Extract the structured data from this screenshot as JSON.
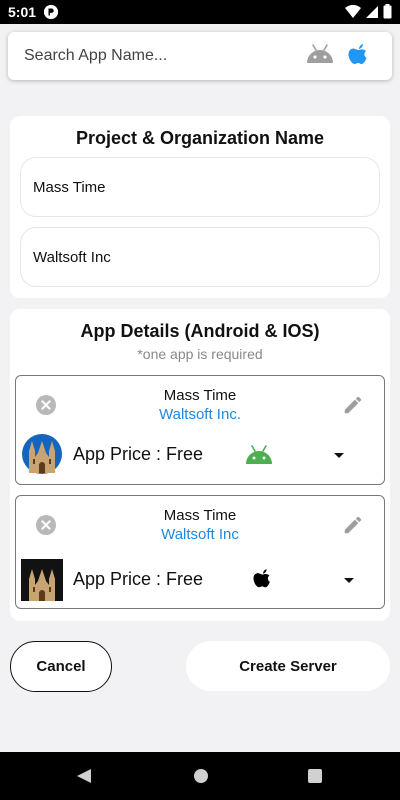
{
  "status_bar": {
    "time": "5:01"
  },
  "search": {
    "placeholder": "Search App Name..."
  },
  "project": {
    "title": "Project & Organization Name",
    "project_name": "Mass Time",
    "organization_name": "Waltsoft Inc"
  },
  "app_details": {
    "title": "App Details (Android & IOS)",
    "note": "*one app is required",
    "apps": [
      {
        "name": "Mass Time",
        "organization": "Waltsoft Inc.",
        "price": "App Price : Free",
        "platform": "android",
        "platform_color": "#4caf50"
      },
      {
        "name": "Mass Time",
        "organization": "Waltsoft Inc",
        "price": "App Price : Free",
        "platform": "ios",
        "platform_color": "#000000"
      }
    ]
  },
  "actions": {
    "cancel": "Cancel",
    "create": "Create Server"
  },
  "colors": {
    "accent_blue": "#1e88e5",
    "apple_blue": "#2196f3",
    "android_green": "#4caf50"
  }
}
